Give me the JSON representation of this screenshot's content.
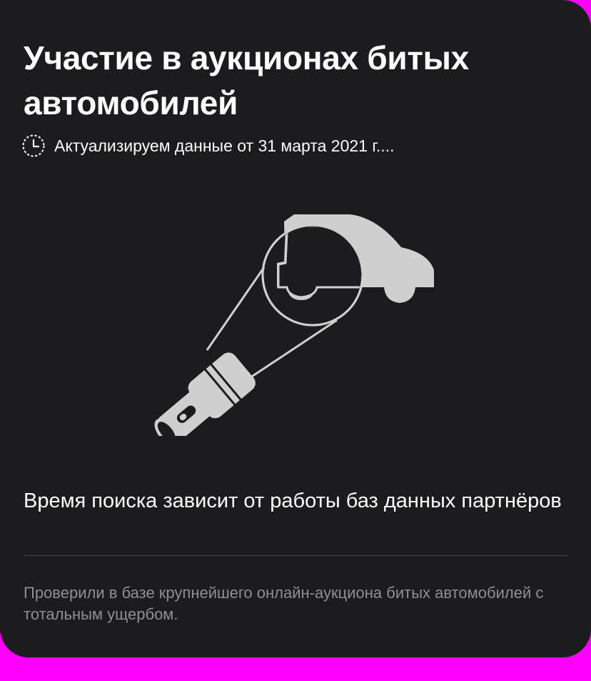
{
  "card": {
    "title": "Участие в аукционах битых автомобилей",
    "status_text": "Актуализируем данные от 31 марта 2021 г....",
    "status_icon": "clock-icon",
    "illustration_icon": "flashlight-car-icon",
    "description": "Время поиска зависит от работы баз данных партнёров",
    "note": "Проверили в базе крупнейшего онлайн-аукциона битых автомобилей с тотальным ущербом."
  },
  "colors": {
    "card_background": "#1c1c1e",
    "page_background": "#ff00ff",
    "text_primary": "#ffffff",
    "text_secondary": "#8e8e93",
    "illustration_fill": "#cfcfcf",
    "divider": "#48484a"
  }
}
